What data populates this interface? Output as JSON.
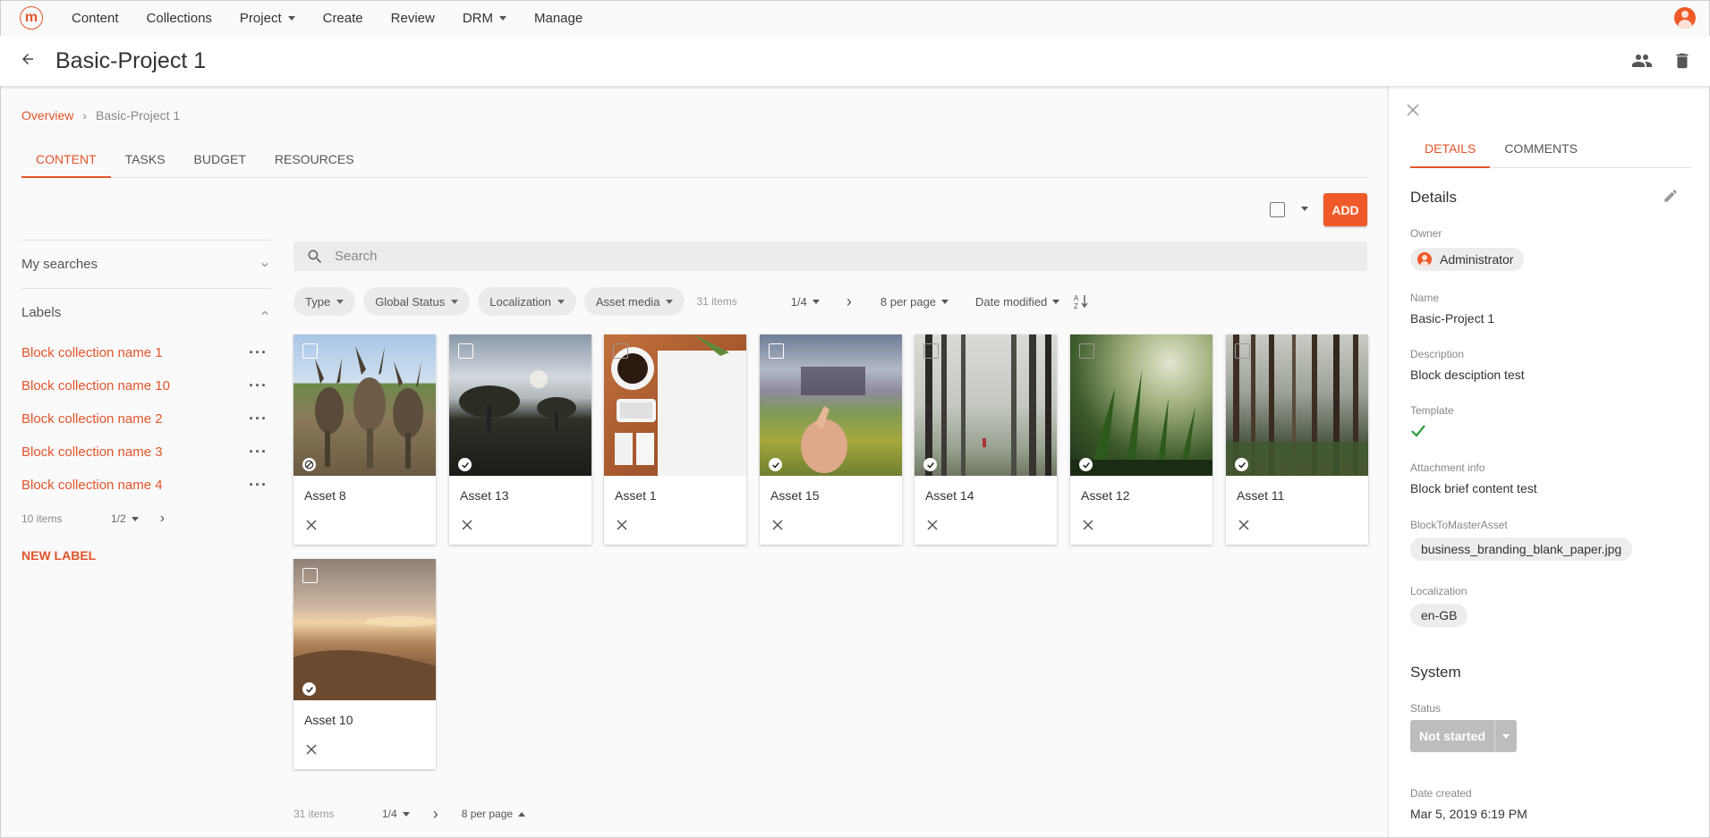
{
  "nav": {
    "logo": "m",
    "items": [
      "Content",
      "Collections",
      "Project",
      "Create",
      "Review",
      "DRM",
      "Manage"
    ]
  },
  "header": {
    "title": "Basic-Project 1"
  },
  "breadcrumb": {
    "root": "Overview",
    "current": "Basic-Project 1"
  },
  "tabs": [
    "CONTENT",
    "TASKS",
    "BUDGET",
    "RESOURCES"
  ],
  "actions": {
    "add_label": "ADD"
  },
  "left": {
    "my_searches": "My searches",
    "labels_title": "Labels",
    "labels": [
      "Block collection name 1",
      "Block collection name 10",
      "Block collection name 2",
      "Block collection name 3",
      "Block collection name 4"
    ],
    "count": "10 items",
    "page": "1/2",
    "new_label": "NEW LABEL"
  },
  "search": {
    "placeholder": "Search"
  },
  "filters": {
    "chips": [
      "Type",
      "Global Status",
      "Localization",
      "Asset media"
    ],
    "count": "31 items",
    "page": "1/4",
    "per_page": "8 per page",
    "sort": "Date modified"
  },
  "assets": [
    {
      "title": "Asset 8",
      "status": "pending"
    },
    {
      "title": "Asset 13",
      "status": "approved"
    },
    {
      "title": "Asset 1",
      "status": "none"
    },
    {
      "title": "Asset 15",
      "status": "approved"
    },
    {
      "title": "Asset 14",
      "status": "approved"
    },
    {
      "title": "Asset 12",
      "status": "approved"
    },
    {
      "title": "Asset 11",
      "status": "approved"
    },
    {
      "title": "Asset 10",
      "status": "approved"
    }
  ],
  "bottom_pager": {
    "count": "31 items",
    "page": "1/4",
    "per_page": "8 per page"
  },
  "details": {
    "tabs": [
      "DETAILS",
      "COMMENTS"
    ],
    "heading": "Details",
    "owner_label": "Owner",
    "owner": "Administrator",
    "name_label": "Name",
    "name": "Basic-Project 1",
    "description_label": "Description",
    "description": "Block desciption test",
    "template_label": "Template",
    "attachment_label": "Attachment info",
    "attachment": "Block brief content test",
    "block_label": "BlockToMasterAsset",
    "block": "business_branding_blank_paper.jpg",
    "localization_label": "Localization",
    "localization": "en-GB",
    "system_heading": "System",
    "status_label": "Status",
    "status": "Not started",
    "date_label": "Date created",
    "date": "Mar 5, 2019 6:19 PM"
  },
  "colors": {
    "accent": "#f05a28",
    "link": "#e2542a"
  },
  "icons": [
    "back-arrow-icon",
    "people-icon",
    "trash-icon",
    "search-icon",
    "sort-icon",
    "close-icon",
    "edit-icon",
    "check-icon",
    "more-icon",
    "chevron-icon"
  ]
}
